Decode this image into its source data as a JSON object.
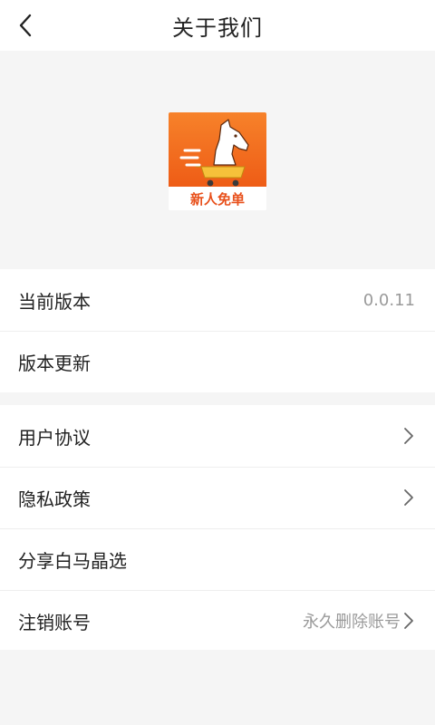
{
  "header": {
    "title": "关于我们"
  },
  "logo": {
    "text": "新人免单",
    "colors": {
      "top": "#f26b1d",
      "bottom": "#ffffff",
      "text": "#e8501b",
      "cart": "#f6c13a"
    }
  },
  "section1": {
    "items": [
      {
        "label": "当前版本",
        "value": "0.0.11"
      },
      {
        "label": "版本更新"
      }
    ]
  },
  "section2": {
    "items": [
      {
        "label": "用户协议"
      },
      {
        "label": "隐私政策"
      },
      {
        "label": "分享白马晶选"
      },
      {
        "label": "注销账号",
        "hint": "永久删除账号"
      }
    ]
  },
  "icons": {
    "back": "chevron-left-icon",
    "chevron": "chevron-right-icon"
  }
}
